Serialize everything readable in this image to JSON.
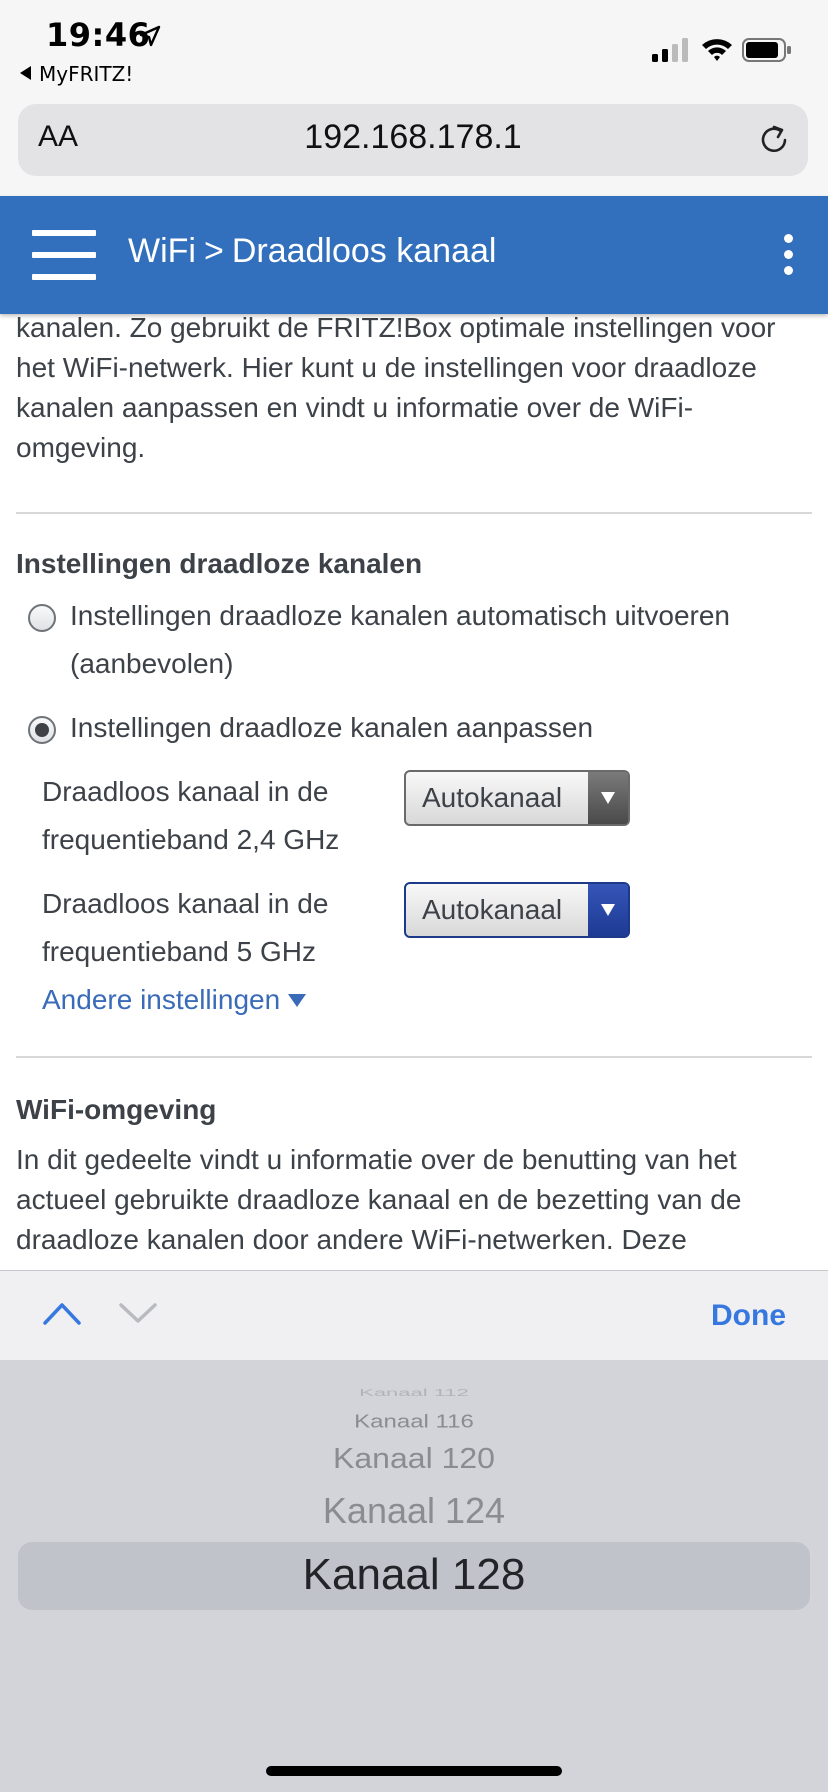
{
  "status_bar": {
    "time": "19:46",
    "back_app": "MyFRITZ!"
  },
  "browser": {
    "text_size_label": "AA",
    "url": "192.168.178.1"
  },
  "header": {
    "breadcrumb_parent": "WiFi",
    "breadcrumb_separator": ">",
    "breadcrumb_current": "Draadloos kanaal"
  },
  "intro": {
    "text": "kanalen. Zo gebruikt de FRITZ!Box optimale instellingen voor het WiFi-netwerk. Hier kunt u de instellingen voor draadloze kanalen aanpassen en vindt u informatie over de WiFi-omgeving."
  },
  "channel_settings": {
    "heading": "Instellingen draadloze kanalen",
    "options": [
      {
        "label": "Instellingen draadloze kanalen automatisch uitvoeren (aanbevolen)",
        "selected": false
      },
      {
        "label": "Instellingen draadloze kanalen aanpassen",
        "selected": true
      }
    ],
    "band_24": {
      "label": "Draadloos kanaal in de frequentieband 2,4 GHz",
      "value": "Autokanaal"
    },
    "band_5": {
      "label": "Draadloos kanaal in de frequentieband 5 GHz",
      "value": "Autokanaal"
    },
    "more_link": "Andere instellingen"
  },
  "wifi_environment": {
    "heading": "WiFi-omgeving",
    "text": "In dit gedeelte vindt u informatie over de benutting van het actueel gebruikte draadloze kanaal en de bezetting van de draadloze kanalen door andere WiFi-netwerken. Deze"
  },
  "keyboard_toolbar": {
    "done_label": "Done"
  },
  "picker": {
    "items": [
      "Kanaal 112",
      "Kanaal 116",
      "Kanaal 120",
      "Kanaal 124",
      "Kanaal 128"
    ],
    "selected": "Kanaal 128"
  },
  "colors": {
    "header_bg": "#3270bd",
    "link": "#3a6bb8",
    "done": "#3778e0"
  }
}
